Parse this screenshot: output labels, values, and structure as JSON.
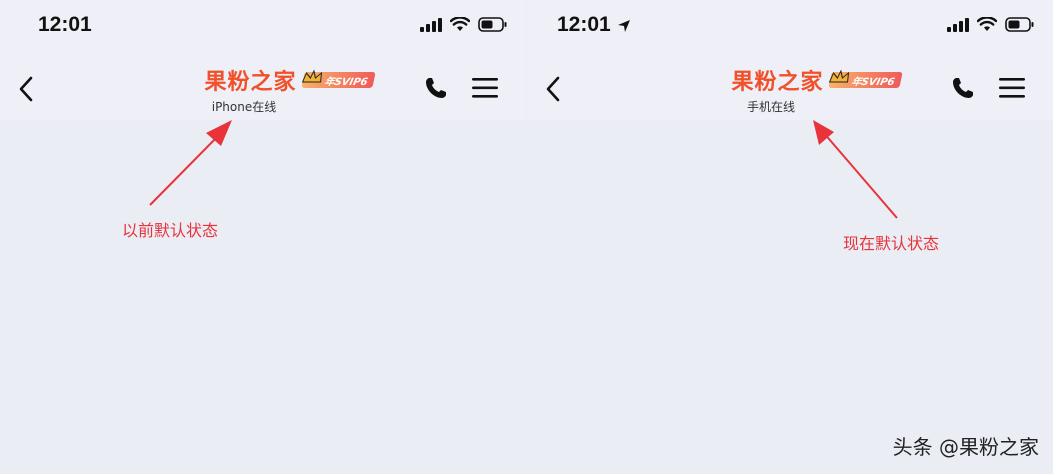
{
  "panels": [
    {
      "time": "12:01",
      "title": "果粉之家",
      "vip": "年SVIP6",
      "subtitle": "iPhone在线",
      "annotation": "以前默认状态"
    },
    {
      "time": "12:01",
      "title": "果粉之家",
      "vip": "年SVIP6",
      "subtitle": "手机在线",
      "annotation": "现在默认状态"
    }
  ],
  "watermark": "头条 @果粉之家",
  "colors": {
    "title": "#f0502a",
    "annotation": "#e8333a",
    "background": "#ebedf5",
    "bar": "#eff0f7"
  },
  "icons": [
    "back-icon",
    "phone-icon",
    "menu-icon",
    "signal-icon",
    "wifi-icon",
    "battery-icon",
    "location-arrow-icon"
  ]
}
